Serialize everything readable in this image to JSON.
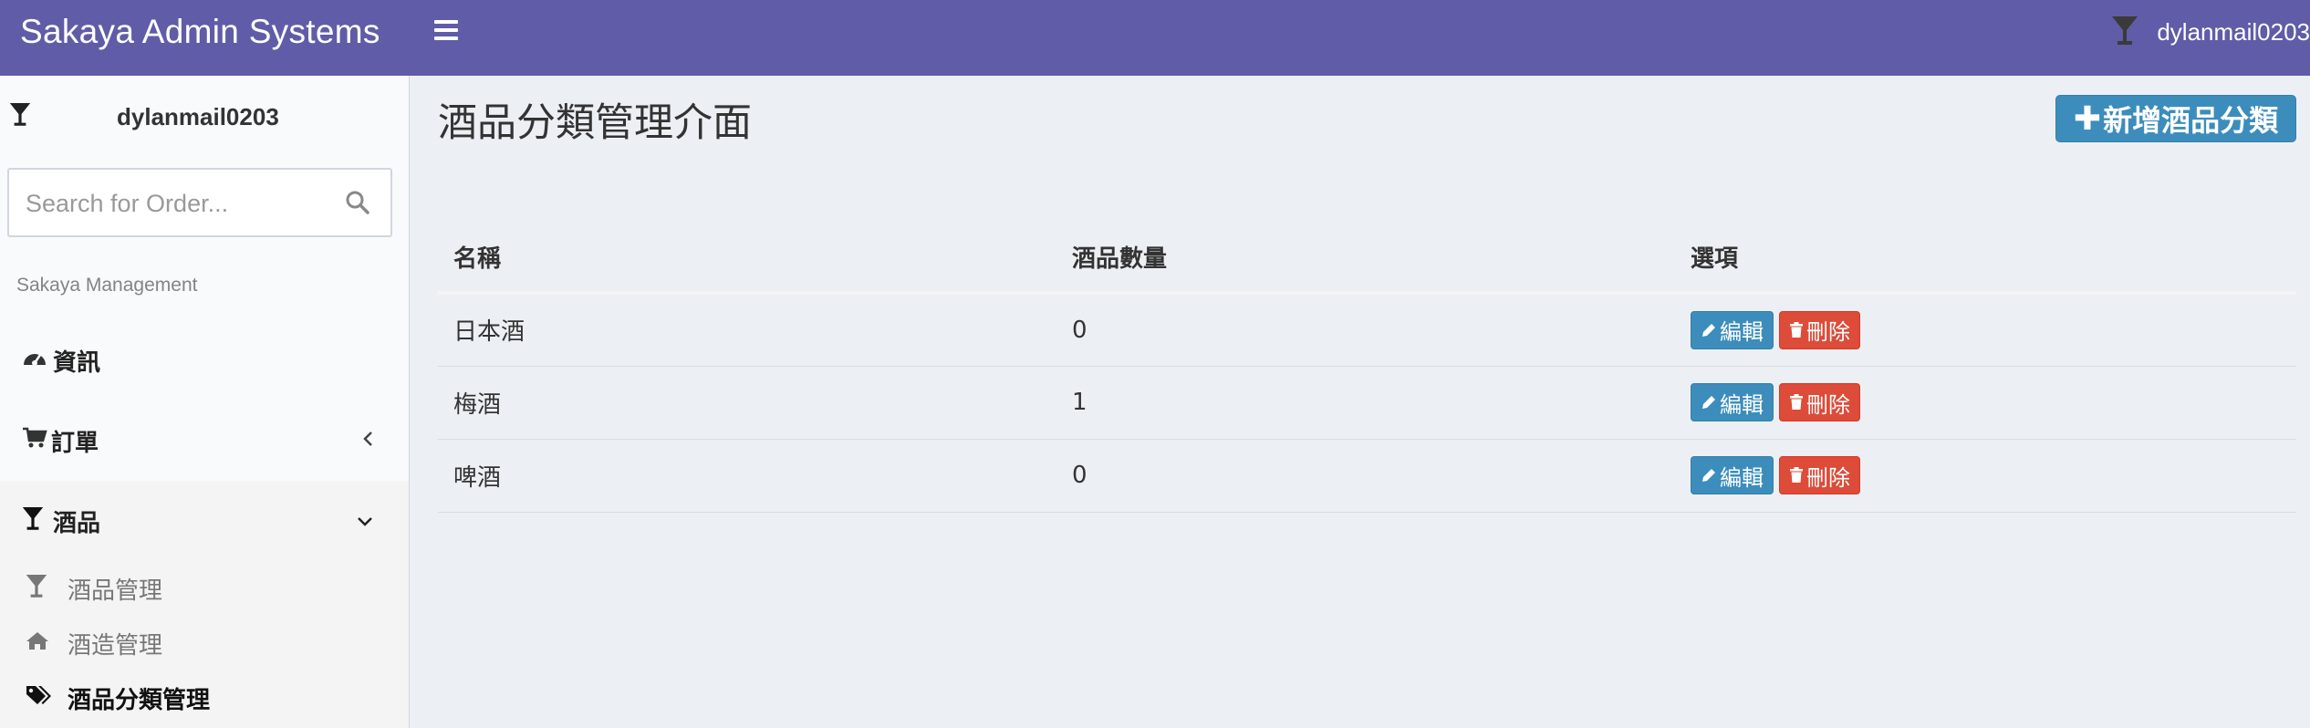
{
  "header": {
    "brand": "Sakaya Admin Systems",
    "user": "dylanmail0203"
  },
  "sidebar": {
    "user": "dylanmail0203",
    "search_placeholder": "Search for Order...",
    "section": "Sakaya Management",
    "items": [
      {
        "label": "資訊",
        "icon": "dashboard-icon"
      },
      {
        "label": "訂單",
        "icon": "cart-icon",
        "chevron": "left"
      },
      {
        "label": "酒品",
        "icon": "glass-icon",
        "chevron": "down"
      }
    ],
    "subitems": [
      {
        "label": "酒品管理",
        "icon": "glass-icon"
      },
      {
        "label": "酒造管理",
        "icon": "home-icon"
      },
      {
        "label": "酒品分類管理",
        "icon": "tags-icon",
        "active": true
      }
    ]
  },
  "main": {
    "title": "酒品分類管理介面",
    "add_button": "新增酒品分類",
    "table": {
      "headers": [
        "名稱",
        "酒品數量",
        "選項"
      ],
      "rows": [
        {
          "name": "日本酒",
          "count": "0"
        },
        {
          "name": "梅酒",
          "count": "1"
        },
        {
          "name": "啤酒",
          "count": "0"
        }
      ],
      "edit_label": "編輯",
      "delete_label": "刪除"
    }
  },
  "colors": {
    "header": "#605ca8",
    "primary": "#3c8dbc",
    "danger": "#dd4b39",
    "content_bg": "#ecf0f5"
  }
}
